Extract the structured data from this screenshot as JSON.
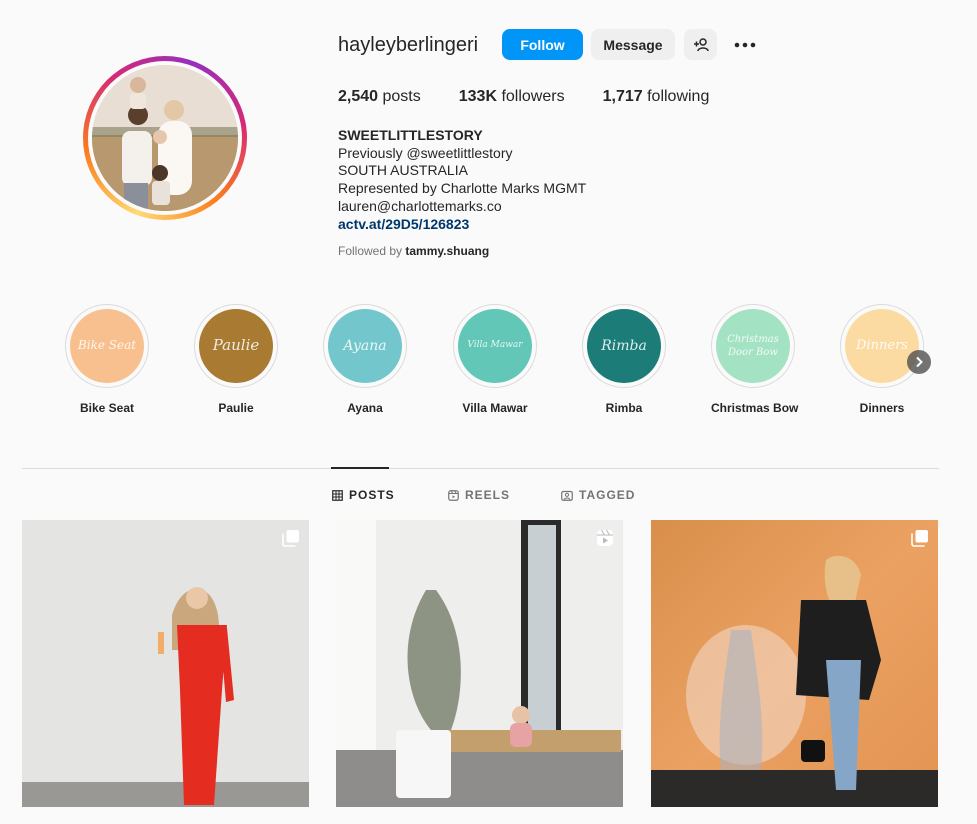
{
  "profile": {
    "username": "hayleyberlingeri",
    "follow_label": "Follow",
    "message_label": "Message",
    "stats": {
      "posts_count": "2,540",
      "posts_label": "posts",
      "followers_count": "133K",
      "followers_label": "followers",
      "following_count": "1,717",
      "following_label": "following"
    },
    "bio": {
      "name": "SWEETLITTLESTORY",
      "lines": [
        "Previously @sweetlittlestory",
        "SOUTH AUSTRALIA",
        "Represented by Charlotte Marks MGMT",
        "lauren@charlottemarks.co"
      ],
      "link": "actv.at/29D5/126823"
    },
    "followed_by_prefix": "Followed by",
    "followed_by_user": "tammy.shuang"
  },
  "highlights": [
    {
      "label": "Bike Seat",
      "cover_text": "Bike Seat",
      "color": "#f9c08f"
    },
    {
      "label": "Paulie",
      "cover_text": "Paulie",
      "color": "#a87a32"
    },
    {
      "label": "Ayana",
      "cover_text": "Ayana",
      "color": "#72c6cc"
    },
    {
      "label": "Villa Mawar",
      "cover_text": "Villa Mawar",
      "color": "#62c7b7"
    },
    {
      "label": "Rimba",
      "cover_text": "Rimba",
      "color": "#1c7c78"
    },
    {
      "label": "Christmas Bow",
      "cover_text": "Christmas Door Bow",
      "color": "#a4e2c4"
    },
    {
      "label": "Dinners",
      "cover_text": "Dinners",
      "color": "#fcdba3"
    }
  ],
  "tabs": [
    {
      "label": "POSTS",
      "icon": "grid-icon",
      "active": true
    },
    {
      "label": "REELS",
      "icon": "reels-icon",
      "active": false
    },
    {
      "label": "TAGGED",
      "icon": "tagged-icon",
      "active": false
    }
  ],
  "posts": [
    {
      "type": "carousel",
      "icon": "carousel-icon"
    },
    {
      "type": "reel",
      "icon": "reel-icon"
    },
    {
      "type": "carousel",
      "icon": "carousel-icon"
    }
  ],
  "colors": {
    "accent": "#0095f6",
    "link": "#00376b",
    "text": "#262626",
    "secondary_text": "#737373",
    "divider": "#dbdbdb"
  }
}
